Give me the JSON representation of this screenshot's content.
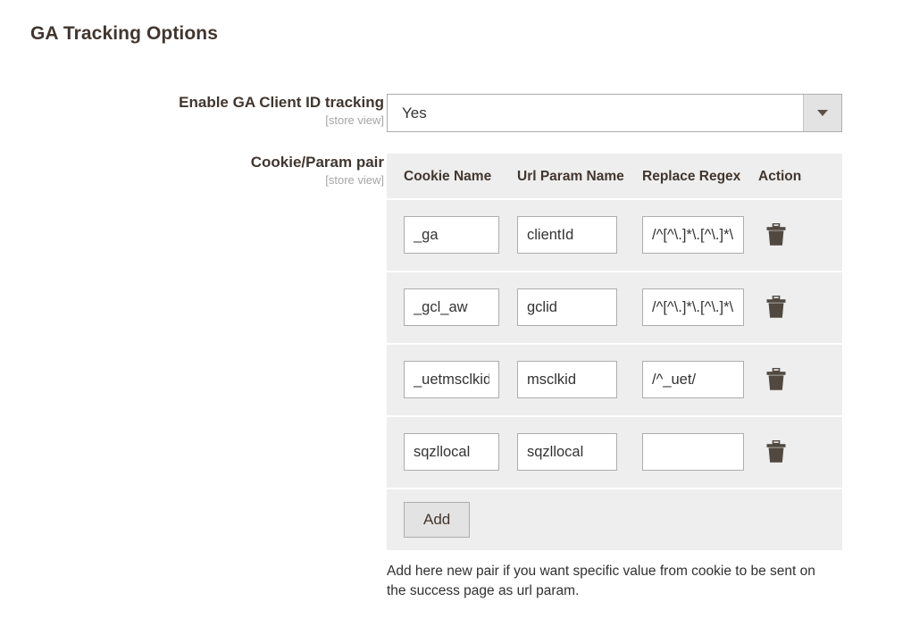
{
  "page": {
    "section_title": "GA Tracking Options"
  },
  "fields": {
    "enable_tracking": {
      "label": "Enable GA Client ID tracking",
      "scope": "[store view]",
      "value": "Yes",
      "caret_icon": "chevron-down-icon"
    },
    "cookie_param_pair": {
      "label": "Cookie/Param pair",
      "scope": "[store view]",
      "columns": {
        "cookie_name": "Cookie Name",
        "url_param_name": "Url Param Name",
        "replace_regex": "Replace Regex",
        "action": "Action"
      },
      "rows": [
        {
          "cookie_name": "_ga",
          "url_param_name": "clientId",
          "replace_regex": "/^[^\\.]*\\.[^\\.]*\\./",
          "delete_icon": "trash-icon"
        },
        {
          "cookie_name": "_gcl_aw",
          "url_param_name": "gclid",
          "replace_regex": "/^[^\\.]*\\.[^\\.]*\\./",
          "delete_icon": "trash-icon"
        },
        {
          "cookie_name": "_uetmsclkid",
          "url_param_name": "msclkid",
          "replace_regex": "/^_uet/",
          "delete_icon": "trash-icon"
        },
        {
          "cookie_name": "sqzllocal",
          "url_param_name": "sqzllocal",
          "replace_regex": "",
          "delete_icon": "trash-icon"
        }
      ],
      "add_label": "Add",
      "help_note": "Add here new pair if you want specific value from cookie to be sent on the success page as url param."
    }
  },
  "colors": {
    "table_bg": "#eeeeee",
    "button_bg": "#e3e3e3",
    "border": "#adadad",
    "label_text": "#41362f",
    "scope_text": "#a6a6a6",
    "icon": "#514840"
  }
}
